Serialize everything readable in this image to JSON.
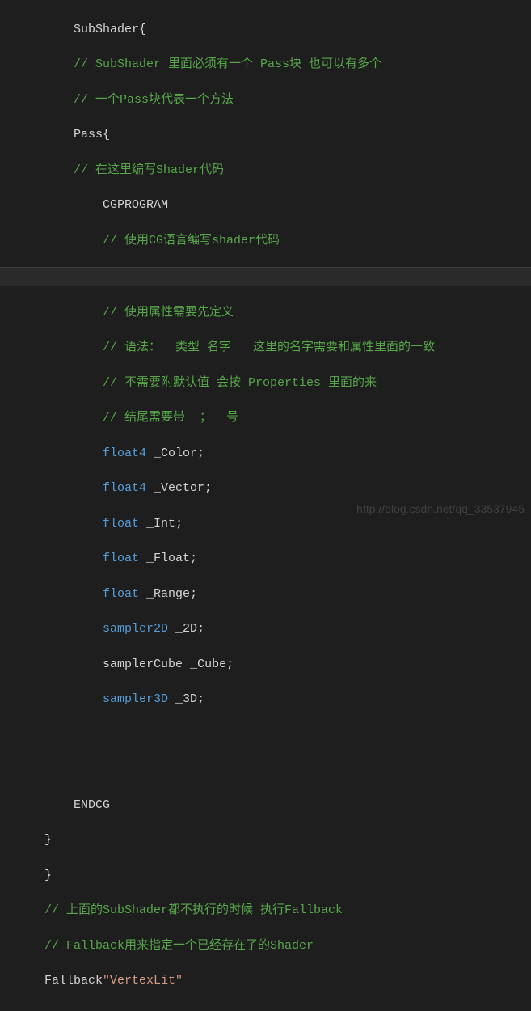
{
  "code": {
    "l1a": "SubShader",
    "l1b": "{",
    "l2": "// SubShader 里面必须有一个 Pass块 也可以有多个",
    "l3": "// 一个Pass块代表一个方法",
    "l4a": "Pass",
    "l4b": "{",
    "l5": "// 在这里编写Shader代码",
    "l6": "CGPROGRAM",
    "l7": "// 使用CG语言编写shader代码",
    "l9": "// 使用属性需要先定义",
    "l10": "// 语法：  类型 名字   这里的名字需要和属性里面的一致",
    "l11": "// 不需要附默认值 会按 Properties 里面的来",
    "l12": "// 结尾需要带  ；  号",
    "l13t": "float4",
    "l13i": " _Color",
    "l14t": "float4",
    "l14i": " _Vector",
    "l15t": "float",
    "l15i": " _Int",
    "l16t": "float",
    "l16i": " _Float",
    "l17t": "float",
    "l17i": " _Range",
    "l18t": "sampler2D",
    "l18i": " _2D",
    "l19t": "samplerCube",
    "l19i": " _Cube",
    "l20t": "sampler3D",
    "l20i": " _3D",
    "semi": ";",
    "l22": "ENDCG",
    "l23": "}",
    "l24": "}",
    "l25": "// 上面的SubShader都不执行的时候 执行Fallback",
    "l26": "// Fallback用来指定一个已经存在了的Shader",
    "l27a": "Fallback",
    "l27b": "\"VertexLit\""
  },
  "watermark": "http://blog.csdn.net/qq_33537945"
}
